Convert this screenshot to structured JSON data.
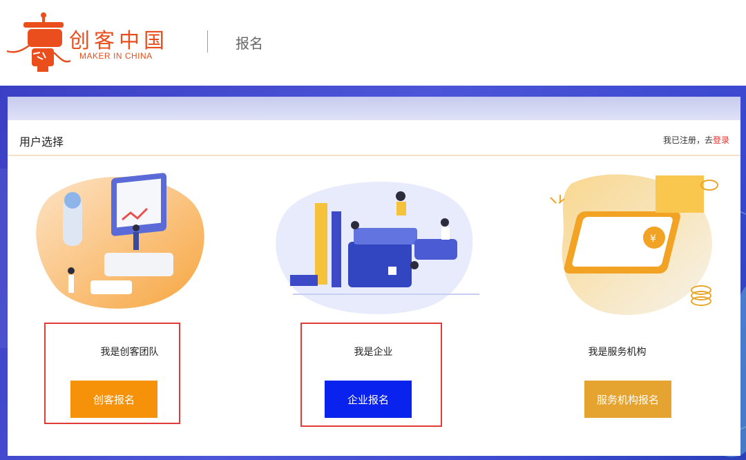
{
  "header": {
    "logo_icon": "maker-robot-logo",
    "brand_cn": "创客中国",
    "brand_en": "MAKER IN CHINA",
    "page_title": "报名"
  },
  "card": {
    "title": "用户选择",
    "login_prompt": "我已注册，去",
    "login_link": "登录"
  },
  "options": [
    {
      "label": "我是创客团队",
      "button": "创客报名",
      "color": "#f5920a",
      "highlighted": true
    },
    {
      "label": "我是企业",
      "button": "企业报名",
      "color": "#0a22ee",
      "highlighted": true
    },
    {
      "label": "我是服务机构",
      "button": "服务机构报名",
      "color": "#e5a330",
      "highlighted": false
    }
  ],
  "colors": {
    "brand": "#e94e1c",
    "band": "#4c55d8",
    "highlight": "#e23a37",
    "login_link": "#e8302a"
  }
}
